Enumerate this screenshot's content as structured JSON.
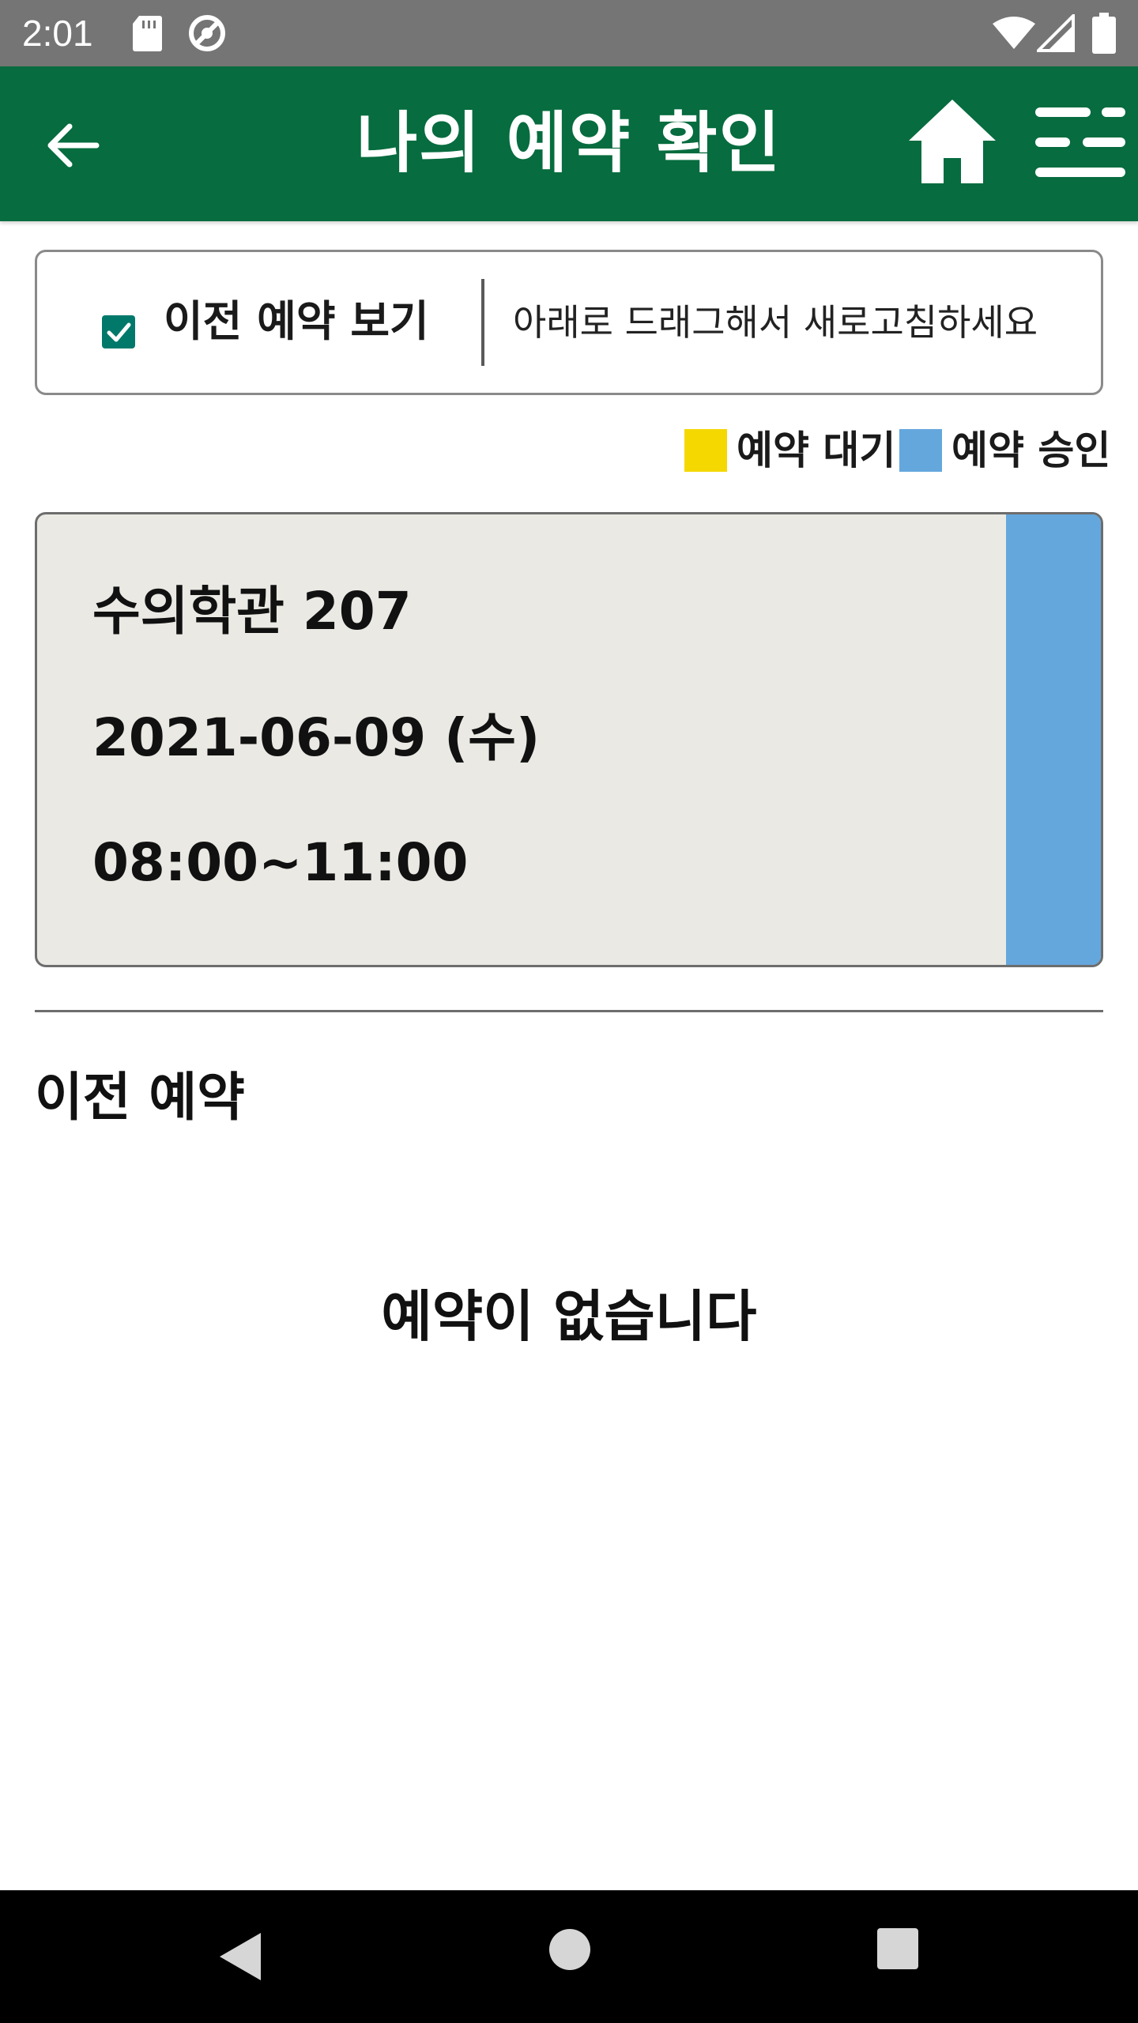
{
  "status_bar": {
    "time": "2:01",
    "icons": [
      "sd-card-icon",
      "sync-icon",
      "wifi-icon",
      "signal-icon",
      "battery-icon"
    ]
  },
  "header": {
    "title": "나의 예약 확인",
    "back_icon": "arrow-left-icon",
    "home_icon": "home-icon",
    "menu_icon": "menu-icon",
    "background_color": "#076c3f"
  },
  "filter": {
    "checkbox_label": "이전 예약 보기",
    "checked": true,
    "refresh_hint": "아래로 드래그해서 새로고침하세요"
  },
  "legend": {
    "items": [
      {
        "label": "예약 대기",
        "color": "#f5d800"
      },
      {
        "label": "예약 승인",
        "color": "#64a7dd"
      }
    ]
  },
  "reservation": {
    "location": "수의학관 207",
    "date": "2021-06-09 (수)",
    "time": "08:00~11:00",
    "status_color": "#64a7dd"
  },
  "previous": {
    "title": "이전 예약",
    "empty_message": "예약이 없습니다"
  },
  "nav_bar": {
    "icons": [
      "nav-back-icon",
      "nav-home-icon",
      "nav-recents-icon"
    ]
  }
}
